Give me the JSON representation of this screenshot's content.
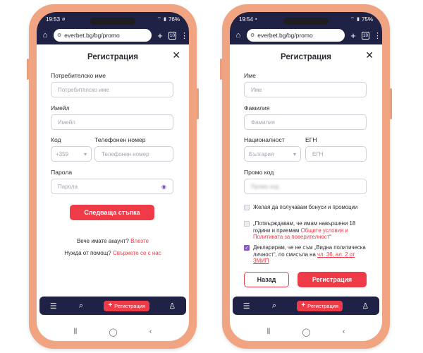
{
  "colors": {
    "frame": "#f0a482",
    "nav_bg": "#1f2244",
    "accent_red": "#ef3b47",
    "checkbox_checked": "#8a56c8",
    "input_border": "#cfd2da"
  },
  "phone1": {
    "status": {
      "time": "19:53",
      "battery": "76%"
    },
    "browser": {
      "url": "everbet.bg/bg/promo",
      "tabs_count": "10"
    },
    "form": {
      "title": "Регистрация",
      "username_label": "Потребителско име",
      "username_placeholder": "Потребителско име",
      "email_label": "Имейл",
      "email_placeholder": "Имейл",
      "code_label": "Код",
      "code_value": "+359",
      "phone_label": "Телефонен номер",
      "phone_placeholder": "Телефонен номер",
      "password_label": "Парола",
      "password_placeholder": "Парола",
      "next_button": "Следваща стъпка",
      "have_account_text": "Вече имате акаунт?",
      "login_link": "Влезте",
      "help_text": "Нужда от помощ?",
      "contact_link": "Свържете се с нас"
    },
    "appnav": {
      "register_label": "Регистрация"
    }
  },
  "phone2": {
    "status": {
      "time": "19:54",
      "battery": "75%"
    },
    "browser": {
      "url": "everbet.bg/bg/promo",
      "tabs_count": "10"
    },
    "form": {
      "title": "Регистрация",
      "first_name_label": "Име",
      "first_name_placeholder": "Име",
      "last_name_label": "Фамилия",
      "last_name_placeholder": "Фамилия",
      "nationality_label": "Националност",
      "nationality_value": "България",
      "egn_label": "ЕГН",
      "egn_placeholder": "ЕГН",
      "promo_label": "Промо код",
      "promo_placeholder": "Промо код",
      "checkbox_bonuses": "Желая да получавам бонуси и промоции",
      "checkbox_age_prefix": "„Потвърждавам, че имам навършени 18 години и приемам ",
      "checkbox_age_link": "Общите условия и Политиката за поверителност",
      "checkbox_age_suffix": "“",
      "checkbox_pep_prefix": "Декларирам, че не съм „Видна политическа личност“, по смисъла на ",
      "checkbox_pep_link": "чл. 36, ал. 2 от ЗМИП",
      "checked_pep": true,
      "back_button": "Назад",
      "register_button": "Регистрация"
    },
    "appnav": {
      "register_label": "Регистрация"
    }
  }
}
